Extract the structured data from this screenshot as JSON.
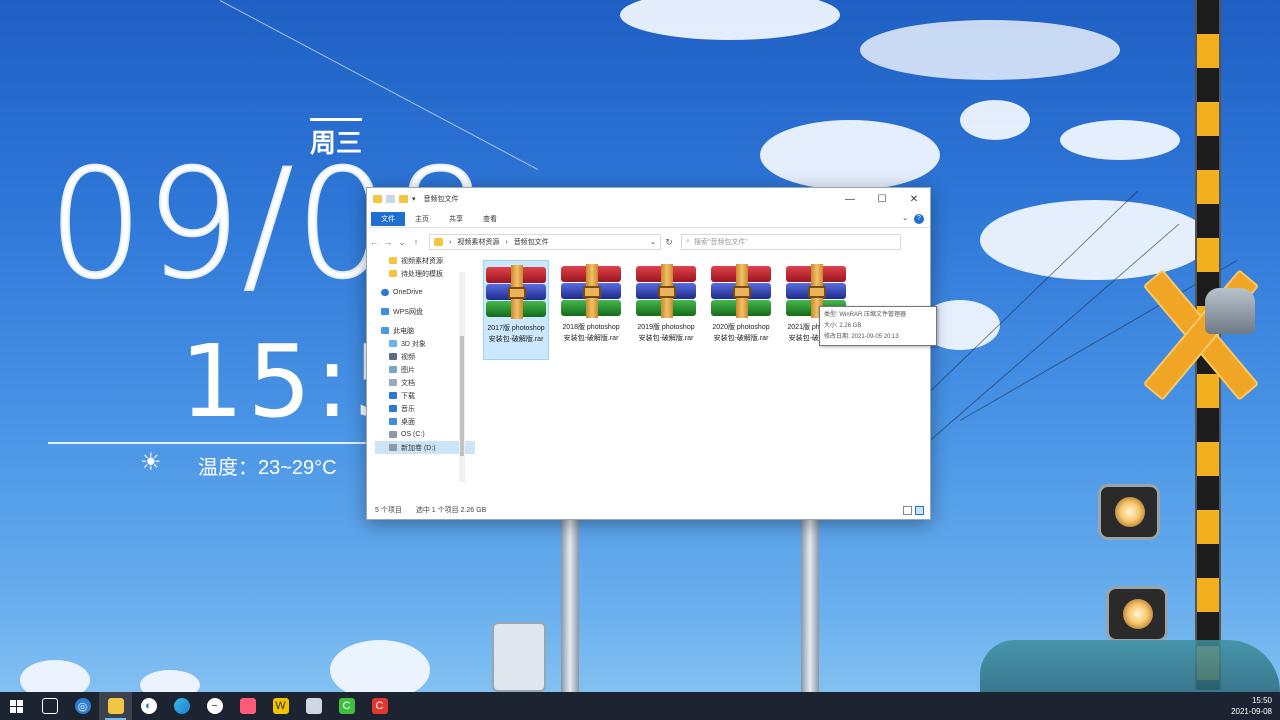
{
  "widget": {
    "weekday": "周三",
    "date": "09/08",
    "time": "15:51",
    "temperature": "温度：23~29°C"
  },
  "window": {
    "title": "音频包文件",
    "ribbon_tabs": [
      "文件",
      "主页",
      "共享",
      "查看"
    ],
    "address": {
      "crumb_1": "视频素材资源",
      "crumb_2": "音频包文件"
    },
    "search_placeholder": "搜索\"音频包文件\"",
    "nav": {
      "quick": [
        "视频素材资源",
        "待处理的模板"
      ],
      "onedrive": "OneDrive",
      "network_top": "WPS网盘",
      "this_pc": "此电脑",
      "pc_items": [
        "3D 对象",
        "视频",
        "图片",
        "文档",
        "下载",
        "音乐",
        "桌面",
        "OS (C:)",
        "新加卷 (D:)"
      ]
    },
    "files": [
      {
        "name": "2017版 photoshop 安装包-破解版.rar"
      },
      {
        "name": "2018版 photoshop 安装包-破解版.rar"
      },
      {
        "name": "2019版 photoshop 安装包-破解版.rar"
      },
      {
        "name": "2020版 photoshop 安装包-破解版.rar"
      },
      {
        "name": "2021版 photoshop 安装包-破解版.rar"
      }
    ],
    "tooltip": {
      "type": "类型: WinRAR 压缩文件管理器",
      "size": "大小: 2.26 GB",
      "modified": "修改日期: 2021-09-05 20:13"
    },
    "status": {
      "count": "5 个项目",
      "selected": "选中 1 个项目  2.26 GB"
    }
  },
  "taskbar": {
    "icons": [
      "windows-start",
      "task-view",
      "search",
      "file-explorer",
      "browser",
      "edge",
      "media",
      "notes",
      "wps",
      "files",
      "camtasia",
      "recorder"
    ],
    "time": "15:50",
    "date": "2021-09-08"
  }
}
